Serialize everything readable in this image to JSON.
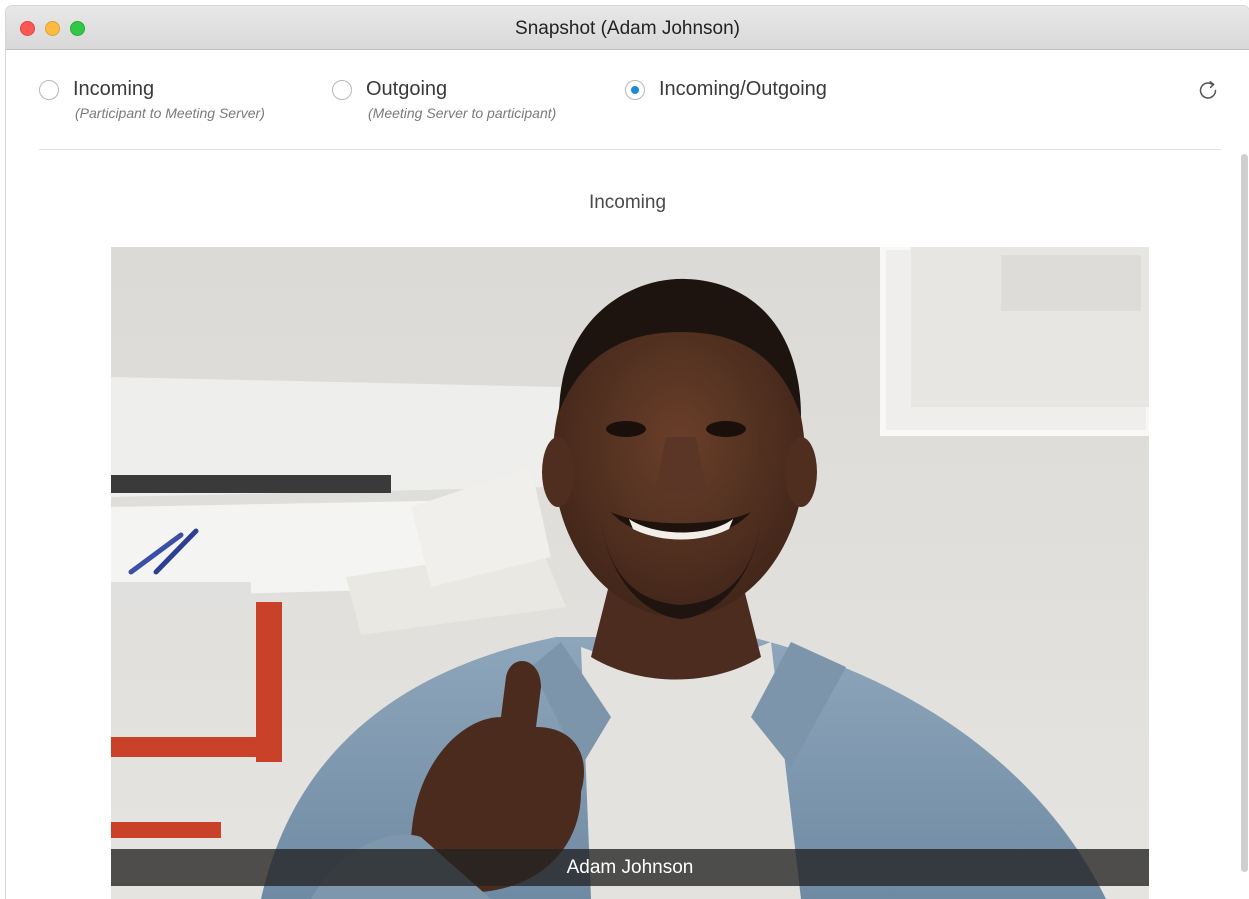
{
  "window": {
    "title": "Snapshot (Adam Johnson)"
  },
  "options": [
    {
      "label": "Incoming",
      "sublabel": "(Participant to Meeting Server)",
      "selected": false
    },
    {
      "label": "Outgoing",
      "sublabel": "(Meeting Server to participant)",
      "selected": false
    },
    {
      "label": "Incoming/Outgoing",
      "sublabel": "",
      "selected": true
    }
  ],
  "refresh": {
    "icon": "refresh-icon"
  },
  "snapshot": {
    "heading": "Incoming",
    "participant_name": "Adam Johnson"
  },
  "colors": {
    "accent": "#1d8bd8",
    "close": "#fc5753",
    "minimize": "#fdbc40",
    "maximize": "#33c748"
  }
}
